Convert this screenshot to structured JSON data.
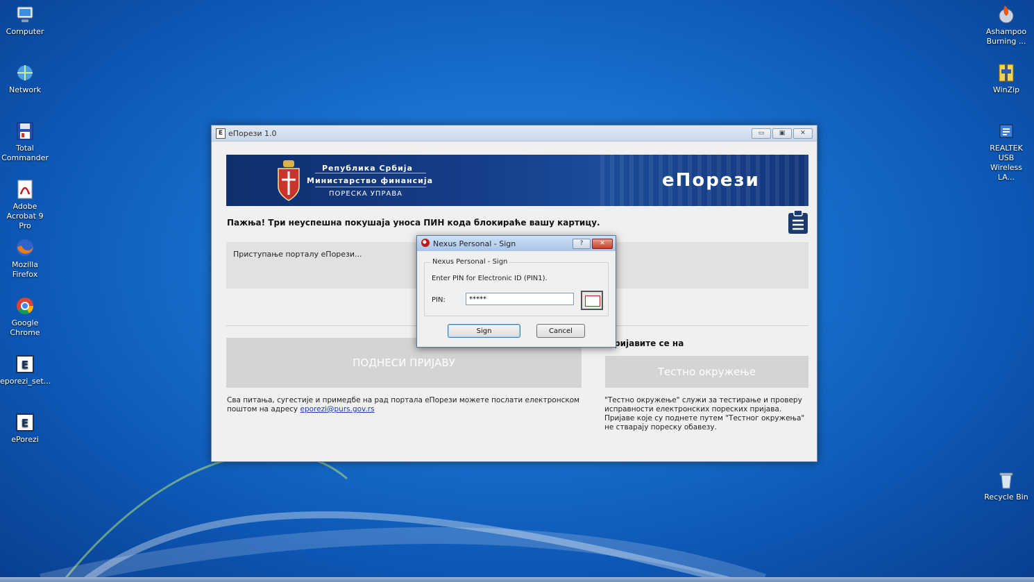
{
  "desktop": {
    "icons_left": [
      {
        "label": "Computer",
        "icon": "computer-icon"
      },
      {
        "label": "Network",
        "icon": "network-icon"
      },
      {
        "label": "Total Commander",
        "icon": "floppy-icon"
      },
      {
        "label": "Adobe Acrobat 9 Pro",
        "icon": "pdf-icon"
      },
      {
        "label": "Mozilla Firefox",
        "icon": "firefox-icon"
      },
      {
        "label": "Google Chrome",
        "icon": "chrome-icon"
      },
      {
        "label": "eporezi_set...",
        "icon": "eporezi-icon"
      },
      {
        "label": "ePorezi",
        "icon": "eporezi-icon"
      }
    ],
    "icons_right": [
      {
        "label": "Ashampoo Burning ...",
        "icon": "burning-icon"
      },
      {
        "label": "WinZip",
        "icon": "winzip-icon"
      },
      {
        "label": "REALTEK USB Wireless LA...",
        "icon": "network-adapter-icon"
      },
      {
        "label": "Recycle Bin",
        "icon": "recycle-bin-icon"
      }
    ]
  },
  "window": {
    "title": "еПорези 1.0",
    "app_icon_letter": "E",
    "buttons": {
      "minimize": "▭",
      "maximize": "▣",
      "close": "✕"
    },
    "banner": {
      "line1": "Република Србија",
      "line2": "Министарство финансија",
      "line3": "ПОРЕСКА УПРАВА",
      "brand": "еПорези"
    },
    "warning": "Пажња! Три неуспешна покушаја уноса ПИН кода блокираће вашу картицу.",
    "status_text": "Приступање порталу еПорези...",
    "submit_button": "ПОДНЕСИ ПРИЈАВУ",
    "register_label": "ријавите се на",
    "test_env_button": "Тестно окружење",
    "info_left_text": "Сва питања, сугестије и примедбе на рад портала еПорези можете послати електронском поштом на адресу",
    "info_left_email": "eporezi@purs.gov.rs",
    "info_right_text": "\"Тестно окружење\" служи за тестирање и проверу исправности електронских пореских пријава. Пријаве које су поднете путем \"Тестног окружења\" не стварају пореску обавезу."
  },
  "dialog": {
    "title": "Nexus Personal - Sign",
    "help_button": "?",
    "close_button": "✕",
    "group_label": "Nexus Personal - Sign",
    "instruction": "Enter PIN for Electronic ID (PIN1).",
    "pin_label": "PIN:",
    "pin_value": "*****",
    "sign_button": "Sign",
    "cancel_button": "Cancel"
  },
  "colors": {
    "desktop": "#1a72cf",
    "banner": "#163f8a",
    "gray_button": "#d4d4d4",
    "link": "#1a3fb0"
  }
}
